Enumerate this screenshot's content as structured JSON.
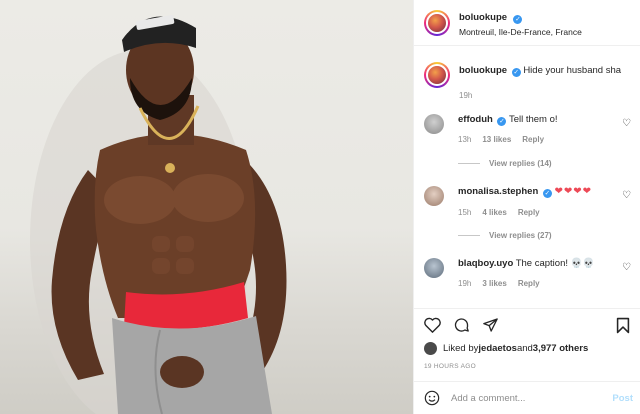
{
  "post": {
    "username": "boluokupe",
    "location": "Montreuil, Ile-De-France, France",
    "verified_glyph": "✓"
  },
  "caption": {
    "username": "boluokupe",
    "text": "Hide your husband sha",
    "time": "19h"
  },
  "comments": [
    {
      "username": "effoduh",
      "text": "Tell them o!",
      "time": "13h",
      "likes": "13 likes",
      "reply": "Reply",
      "view_replies": "View replies (14)"
    },
    {
      "username": "monalisa.stephen",
      "text": "❤❤❤❤",
      "time": "15h",
      "likes": "4 likes",
      "reply": "Reply",
      "view_replies": "View replies (27)"
    },
    {
      "username": "blaqboy.uyo",
      "text": "The caption! 💀💀",
      "time": "19h",
      "likes": "3 likes",
      "reply": "Reply"
    }
  ],
  "engagement": {
    "liked_by_prefix": "Liked by ",
    "liked_by_user": "jedaetos",
    "liked_by_and": " and ",
    "liked_by_count": "3,977 others",
    "time_ago": "19 HOURS AGO"
  },
  "composer": {
    "placeholder": "Add a comment...",
    "post_label": "Post"
  },
  "icons": {
    "like": "heart-outline-icon",
    "comment": "comment-bubble-icon",
    "share": "paper-plane-icon",
    "save": "bookmark-icon",
    "emoji": "smiley-icon",
    "comment_like": "heart-small-icon"
  },
  "colors": {
    "link_blue": "#3897f0",
    "post_disabled": "#b2dffc",
    "heart_red": "#ed4956",
    "muted": "#8e8e8e"
  }
}
